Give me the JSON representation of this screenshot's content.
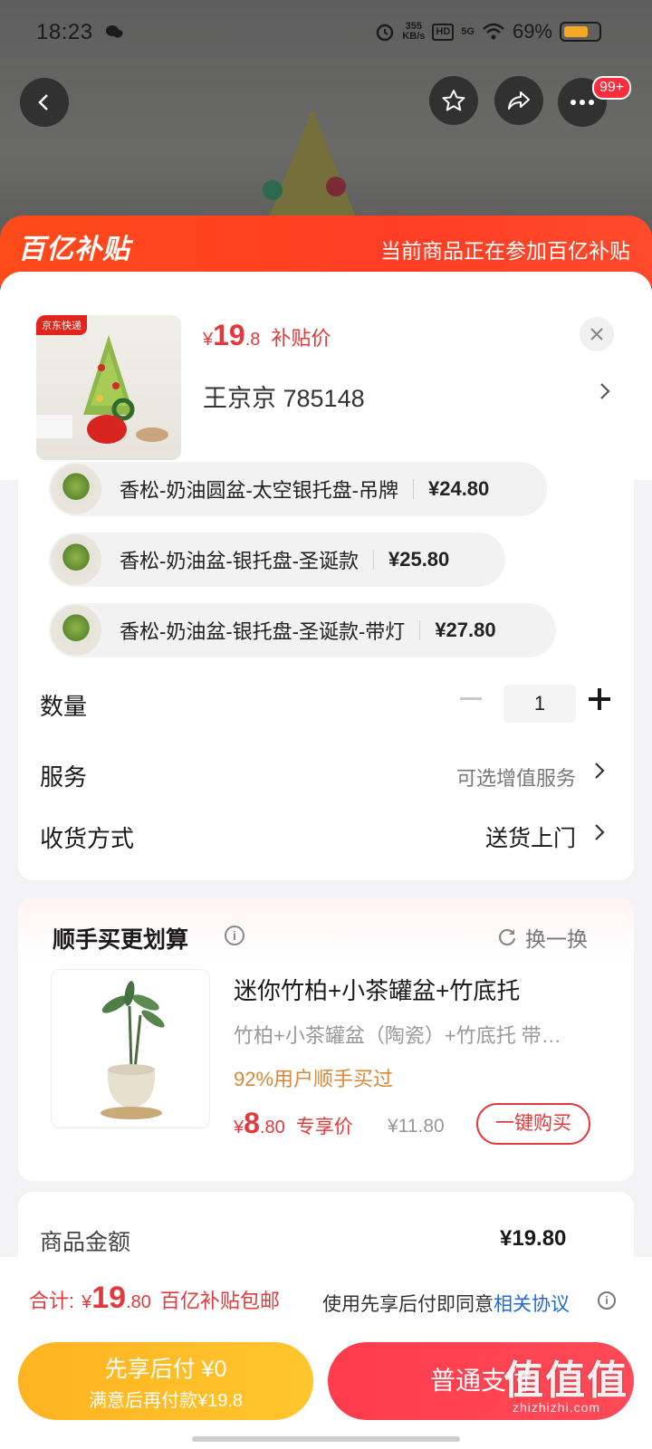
{
  "status_bar": {
    "time": "18:23",
    "net_speed_top": "355",
    "net_speed_unit": "KB/s",
    "hd_label": "HD",
    "network": "5G",
    "battery": "69%"
  },
  "nav": {
    "badge": "99+"
  },
  "subsidy": {
    "logo": "百亿补贴",
    "note": "当前商品正在参加百亿补贴"
  },
  "product": {
    "thumb_tag": "京东快递",
    "price_symbol": "¥",
    "price_int": "19",
    "price_dec": ".8",
    "price_label": "补贴价",
    "address": "王京京  785148"
  },
  "variants": [
    {
      "name": "香松-奶油圆盆-太空银托盘-吊牌",
      "price": "¥24.80"
    },
    {
      "name": "香松-奶油盆-银托盘-圣诞款",
      "price": "¥25.80"
    },
    {
      "name": "香松-奶油盆-银托盘-圣诞款-带灯",
      "price": "¥27.80"
    }
  ],
  "quantity": {
    "label": "数量",
    "value": "1"
  },
  "service": {
    "label": "服务",
    "value": "可选增值服务"
  },
  "delivery": {
    "label": "收货方式",
    "value": "送货上门"
  },
  "recommend": {
    "title": "顺手买更划算",
    "refresh": "换一换",
    "name": "迷你竹柏+小茶罐盆+竹底托",
    "desc": "竹柏+小茶罐盆（陶瓷）+竹底托   带…",
    "percent": "92%用户顺手买过",
    "price_symbol": "¥",
    "price_int": "8",
    "price_dec": ".80",
    "price_label": "专享价",
    "original_price": "¥11.80",
    "buy_label": "一键购买"
  },
  "amount": {
    "label": "商品金额",
    "value": "¥19.80"
  },
  "bottom": {
    "total_label": "合计:",
    "total_symbol": "¥",
    "total_int": "19",
    "total_dec": ".80",
    "total_note": "百亿补贴包邮",
    "agree_prefix": "使用先享后付即同意",
    "agree_link": "相关协议",
    "later_line1": "先享后付 ¥0",
    "later_line2": "满意后再付款¥19.8",
    "normal_pay": "普通支付"
  },
  "watermark": {
    "main": "值值值",
    "sub": "zhizhizhi.com"
  },
  "colors": {
    "accent_red": "#e4393c",
    "subsidy_orange": "#ff4a1a",
    "pay_later_yellow": "#ffb321",
    "link_blue": "#1e6ad8"
  }
}
